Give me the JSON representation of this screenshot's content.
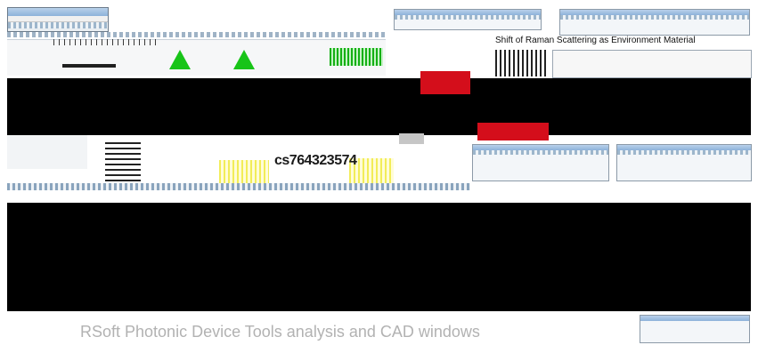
{
  "caption": "RSoft Photonic Device Tools analysis and CAD windows",
  "watermark": "cs764323574",
  "plot_window": {
    "title": "Shift of Raman Scattering as Environment Material"
  },
  "colors": {
    "accent_green": "#18c418",
    "accent_red": "#d40e1b",
    "title_blue": "#8db2da",
    "caption_gray": "#b2b2b2"
  },
  "icons": [
    "window-icon",
    "toolbar-icon"
  ]
}
